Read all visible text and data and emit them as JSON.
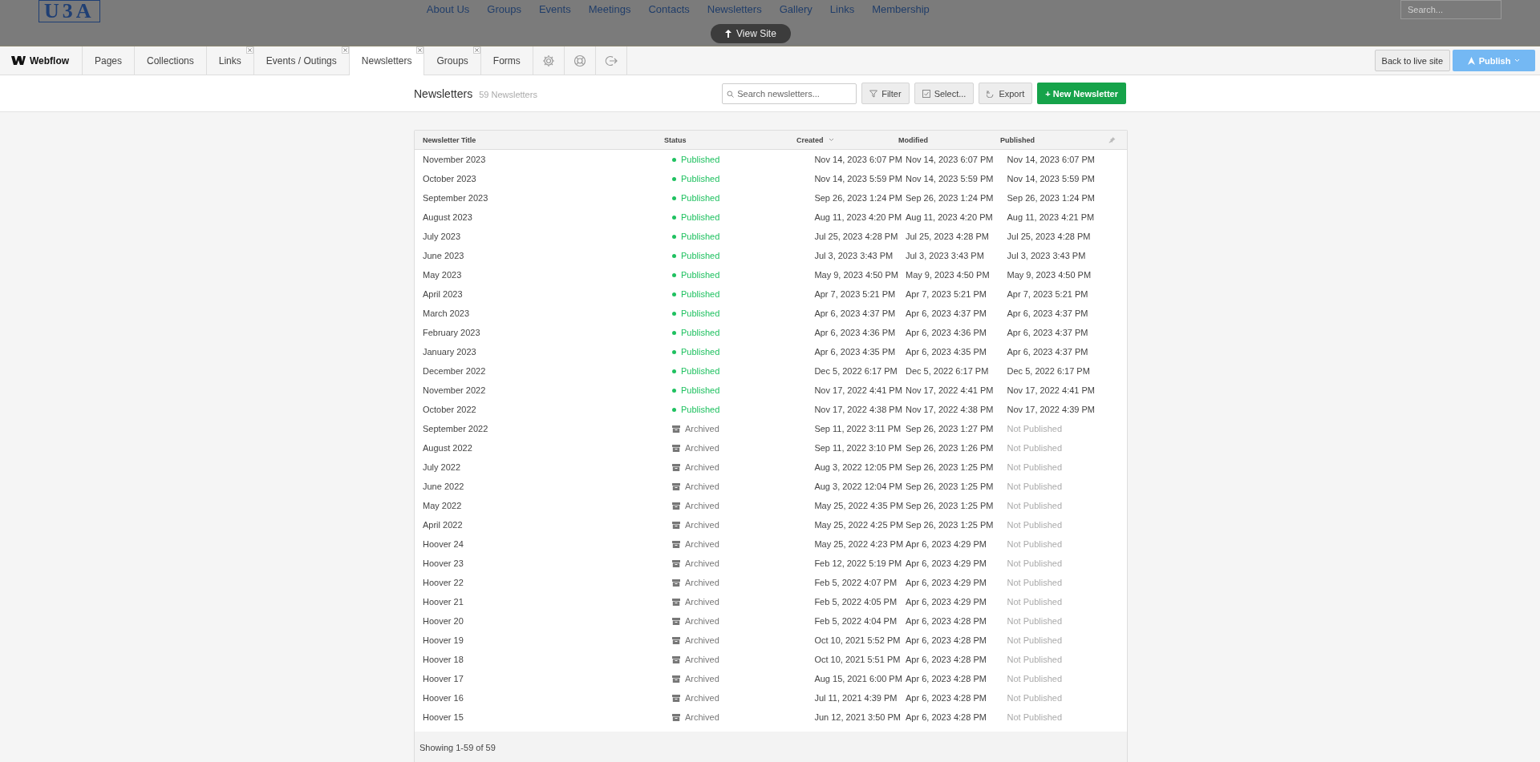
{
  "site_header": {
    "logo": "U3A",
    "nav": [
      "About Us",
      "Groups",
      "Events",
      "Meetings",
      "Contacts",
      "Newsletters",
      "Gallery",
      "Links",
      "Membership"
    ],
    "search": {
      "placeholder": "Search..."
    },
    "view_site": "View Site"
  },
  "editor_bar": {
    "brand": "Webflow",
    "tabs": [
      {
        "label": "Pages",
        "selected": false,
        "closable": false
      },
      {
        "label": "Collections",
        "selected": false,
        "closable": false
      },
      {
        "label": "Links",
        "selected": false,
        "closable": true
      },
      {
        "label": "Events / Outings",
        "selected": false,
        "closable": true
      },
      {
        "label": "Newsletters",
        "selected": true,
        "closable": true
      },
      {
        "label": "Groups",
        "selected": false,
        "closable": true
      },
      {
        "label": "Forms",
        "selected": false,
        "closable": false
      }
    ],
    "back_button": "Back to live site",
    "publish_button": "Publish"
  },
  "toolbar": {
    "title": "Newsletters",
    "count": "59 Newsletters",
    "search": {
      "placeholder": "Search newsletters..."
    },
    "filter": "Filter",
    "select": "Select...",
    "export": "Export",
    "new_button": "+ New Newsletter"
  },
  "table": {
    "columns": [
      "Newsletter Title",
      "Status",
      "Created",
      "Modified",
      "Published"
    ],
    "rows": [
      {
        "title": "November 2023",
        "status": "Published",
        "kind": "published",
        "created": "Nov 14, 2023 6:07 PM",
        "modified": "Nov 14, 2023 6:07 PM",
        "published": "Nov 14, 2023 6:07 PM"
      },
      {
        "title": "October 2023",
        "status": "Published",
        "kind": "published",
        "created": "Nov 14, 2023 5:59 PM",
        "modified": "Nov 14, 2023 5:59 PM",
        "published": "Nov 14, 2023 5:59 PM"
      },
      {
        "title": "September 2023",
        "status": "Published",
        "kind": "published",
        "created": "Sep 26, 2023 1:24 PM",
        "modified": "Sep 26, 2023 1:24 PM",
        "published": "Sep 26, 2023 1:24 PM"
      },
      {
        "title": "August 2023",
        "status": "Published",
        "kind": "published",
        "created": "Aug 11, 2023 4:20 PM",
        "modified": "Aug 11, 2023 4:20 PM",
        "published": "Aug 11, 2023 4:21 PM"
      },
      {
        "title": "July 2023",
        "status": "Published",
        "kind": "published",
        "created": "Jul 25, 2023 4:28 PM",
        "modified": "Jul 25, 2023 4:28 PM",
        "published": "Jul 25, 2023 4:28 PM"
      },
      {
        "title": "June 2023",
        "status": "Published",
        "kind": "published",
        "created": "Jul 3, 2023 3:43 PM",
        "modified": "Jul 3, 2023 3:43 PM",
        "published": "Jul 3, 2023 3:43 PM"
      },
      {
        "title": "May 2023",
        "status": "Published",
        "kind": "published",
        "created": "May 9, 2023 4:50 PM",
        "modified": "May 9, 2023 4:50 PM",
        "published": "May 9, 2023 4:50 PM"
      },
      {
        "title": "April 2023",
        "status": "Published",
        "kind": "published",
        "created": "Apr 7, 2023 5:21 PM",
        "modified": "Apr 7, 2023 5:21 PM",
        "published": "Apr 7, 2023 5:21 PM"
      },
      {
        "title": "March 2023",
        "status": "Published",
        "kind": "published",
        "created": "Apr 6, 2023 4:37 PM",
        "modified": "Apr 6, 2023 4:37 PM",
        "published": "Apr 6, 2023 4:37 PM"
      },
      {
        "title": "February 2023",
        "status": "Published",
        "kind": "published",
        "created": "Apr 6, 2023 4:36 PM",
        "modified": "Apr 6, 2023 4:36 PM",
        "published": "Apr 6, 2023 4:37 PM"
      },
      {
        "title": "January 2023",
        "status": "Published",
        "kind": "published",
        "created": "Apr 6, 2023 4:35 PM",
        "modified": "Apr 6, 2023 4:35 PM",
        "published": "Apr 6, 2023 4:37 PM"
      },
      {
        "title": "December 2022",
        "status": "Published",
        "kind": "published",
        "created": "Dec 5, 2022 6:17 PM",
        "modified": "Dec 5, 2022 6:17 PM",
        "published": "Dec 5, 2022 6:17 PM"
      },
      {
        "title": "November 2022",
        "status": "Published",
        "kind": "published",
        "created": "Nov 17, 2022 4:41 PM",
        "modified": "Nov 17, 2022 4:41 PM",
        "published": "Nov 17, 2022 4:41 PM"
      },
      {
        "title": "October 2022",
        "status": "Published",
        "kind": "published",
        "created": "Nov 17, 2022 4:38 PM",
        "modified": "Nov 17, 2022 4:38 PM",
        "published": "Nov 17, 2022 4:39 PM"
      },
      {
        "title": "September 2022",
        "status": "Archived",
        "kind": "archived",
        "created": "Sep 11, 2022 3:11 PM",
        "modified": "Sep 26, 2023 1:27 PM",
        "published": "Not Published"
      },
      {
        "title": "August 2022",
        "status": "Archived",
        "kind": "archived",
        "created": "Sep 11, 2022 3:10 PM",
        "modified": "Sep 26, 2023 1:26 PM",
        "published": "Not Published"
      },
      {
        "title": "July 2022",
        "status": "Archived",
        "kind": "archived",
        "created": "Aug 3, 2022 12:05 PM",
        "modified": "Sep 26, 2023 1:25 PM",
        "published": "Not Published"
      },
      {
        "title": "June 2022",
        "status": "Archived",
        "kind": "archived",
        "created": "Aug 3, 2022 12:04 PM",
        "modified": "Sep 26, 2023 1:25 PM",
        "published": "Not Published"
      },
      {
        "title": "May 2022",
        "status": "Archived",
        "kind": "archived",
        "created": "May 25, 2022 4:35 PM",
        "modified": "Sep 26, 2023 1:25 PM",
        "published": "Not Published"
      },
      {
        "title": "April 2022",
        "status": "Archived",
        "kind": "archived",
        "created": "May 25, 2022 4:25 PM",
        "modified": "Sep 26, 2023 1:25 PM",
        "published": "Not Published"
      },
      {
        "title": "Hoover 24",
        "status": "Archived",
        "kind": "archived",
        "created": "May 25, 2022 4:23 PM",
        "modified": "Apr 6, 2023 4:29 PM",
        "published": "Not Published"
      },
      {
        "title": "Hoover 23",
        "status": "Archived",
        "kind": "archived",
        "created": "Feb 12, 2022 5:19 PM",
        "modified": "Apr 6, 2023 4:29 PM",
        "published": "Not Published"
      },
      {
        "title": "Hoover 22",
        "status": "Archived",
        "kind": "archived",
        "created": "Feb 5, 2022 4:07 PM",
        "modified": "Apr 6, 2023 4:29 PM",
        "published": "Not Published"
      },
      {
        "title": "Hoover 21",
        "status": "Archived",
        "kind": "archived",
        "created": "Feb 5, 2022 4:05 PM",
        "modified": "Apr 6, 2023 4:29 PM",
        "published": "Not Published"
      },
      {
        "title": "Hoover 20",
        "status": "Archived",
        "kind": "archived",
        "created": "Feb 5, 2022 4:04 PM",
        "modified": "Apr 6, 2023 4:28 PM",
        "published": "Not Published"
      },
      {
        "title": "Hoover 19",
        "status": "Archived",
        "kind": "archived",
        "created": "Oct 10, 2021 5:52 PM",
        "modified": "Apr 6, 2023 4:28 PM",
        "published": "Not Published"
      },
      {
        "title": "Hoover 18",
        "status": "Archived",
        "kind": "archived",
        "created": "Oct 10, 2021 5:51 PM",
        "modified": "Apr 6, 2023 4:28 PM",
        "published": "Not Published"
      },
      {
        "title": "Hoover 17",
        "status": "Archived",
        "kind": "archived",
        "created": "Aug 15, 2021 6:00 PM",
        "modified": "Apr 6, 2023 4:28 PM",
        "published": "Not Published"
      },
      {
        "title": "Hoover 16",
        "status": "Archived",
        "kind": "archived",
        "created": "Jul 11, 2021 4:39 PM",
        "modified": "Apr 6, 2023 4:28 PM",
        "published": "Not Published"
      },
      {
        "title": "Hoover 15",
        "status": "Archived",
        "kind": "archived",
        "created": "Jun 12, 2021 3:50 PM",
        "modified": "Apr 6, 2023 4:28 PM",
        "published": "Not Published"
      }
    ],
    "footer": "Showing 1-59 of 59"
  }
}
